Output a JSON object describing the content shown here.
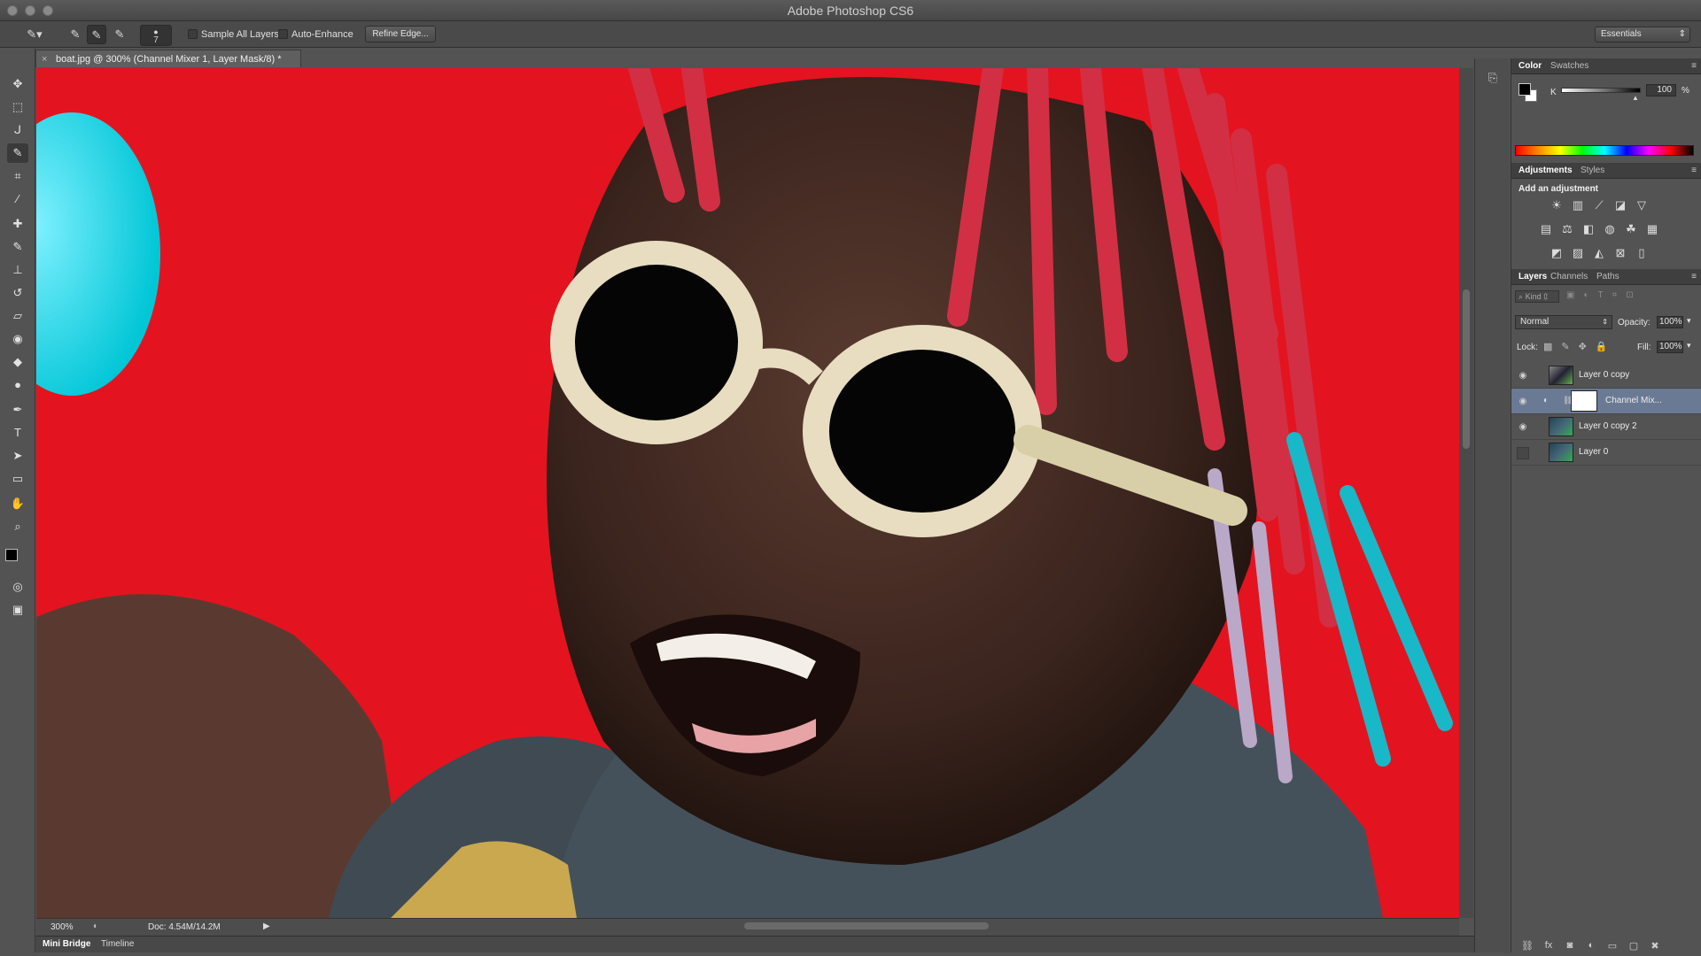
{
  "app": {
    "title": "Adobe Photoshop CS6",
    "workspace": "Essentials"
  },
  "options_bar": {
    "brush_size": "7",
    "sample_all_layers": "Sample All Layers",
    "auto_enhance": "Auto-Enhance",
    "refine_edge": "Refine Edge..."
  },
  "document": {
    "tab_label": "boat.jpg @ 300% (Channel Mixer 1, Layer Mask/8) *",
    "close": "×"
  },
  "status_bar": {
    "zoom": "300%",
    "doc_info": "Doc: 4.54M/14.2M"
  },
  "bottom_tabs": [
    "Mini Bridge",
    "Timeline"
  ],
  "color_panel": {
    "tabs": [
      "Color",
      "Swatches"
    ],
    "channel": "K",
    "value": "100",
    "unit": "%"
  },
  "adjustments_panel": {
    "tabs": [
      "Adjustments",
      "Styles"
    ],
    "heading": "Add an adjustment"
  },
  "layers_panel": {
    "tabs": [
      "Layers",
      "Channels",
      "Paths"
    ],
    "kind_filter": "Kind",
    "blend_mode": "Normal",
    "opacity_label": "Opacity:",
    "opacity_value": "100%",
    "lock_label": "Lock:",
    "fill_label": "Fill:",
    "fill_value": "100%",
    "layers": [
      {
        "name": "Layer 0 copy",
        "visible": true,
        "selected": false
      },
      {
        "name": "Channel Mix...",
        "visible": true,
        "selected": true
      },
      {
        "name": "Layer 0 copy 2",
        "visible": true,
        "selected": false
      },
      {
        "name": "Layer 0",
        "visible": false,
        "selected": false
      }
    ]
  },
  "colors": {
    "background_red": "#e41320",
    "ui_dark": "#535353",
    "selection": "#6b7a94"
  }
}
